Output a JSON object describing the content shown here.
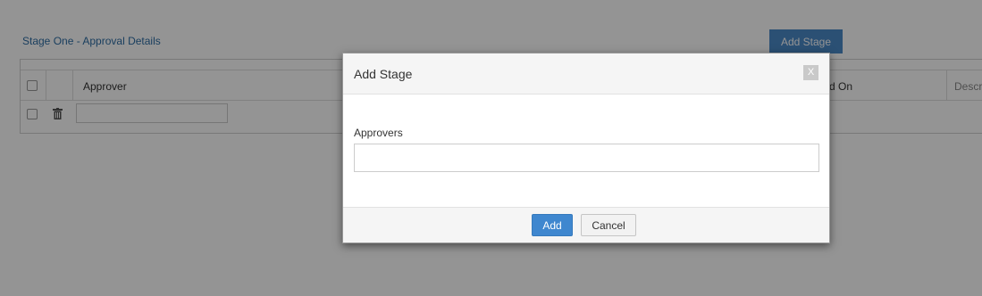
{
  "page": {
    "section_title": "Stage One - Approval Details",
    "add_stage_label": "Add Stage"
  },
  "grid": {
    "columns": [
      {
        "key": "select",
        "label": ""
      },
      {
        "key": "actions",
        "label": ""
      },
      {
        "key": "approver",
        "label": "Approver"
      },
      {
        "key": "approved_on",
        "label": "d On"
      },
      {
        "key": "description",
        "label": "Descr"
      }
    ],
    "rows": [
      {
        "approver": ""
      }
    ]
  },
  "modal": {
    "title": "Add Stage",
    "close_label": "X",
    "field_label": "Approvers",
    "field_value": "",
    "add_label": "Add",
    "cancel_label": "Cancel"
  },
  "colors": {
    "accent": "#3f87cf",
    "title_link": "#2e6da4",
    "overlay": "rgba(0,0,0,0.42)"
  },
  "icons": [
    "trash-icon",
    "close-icon",
    "checkbox"
  ]
}
